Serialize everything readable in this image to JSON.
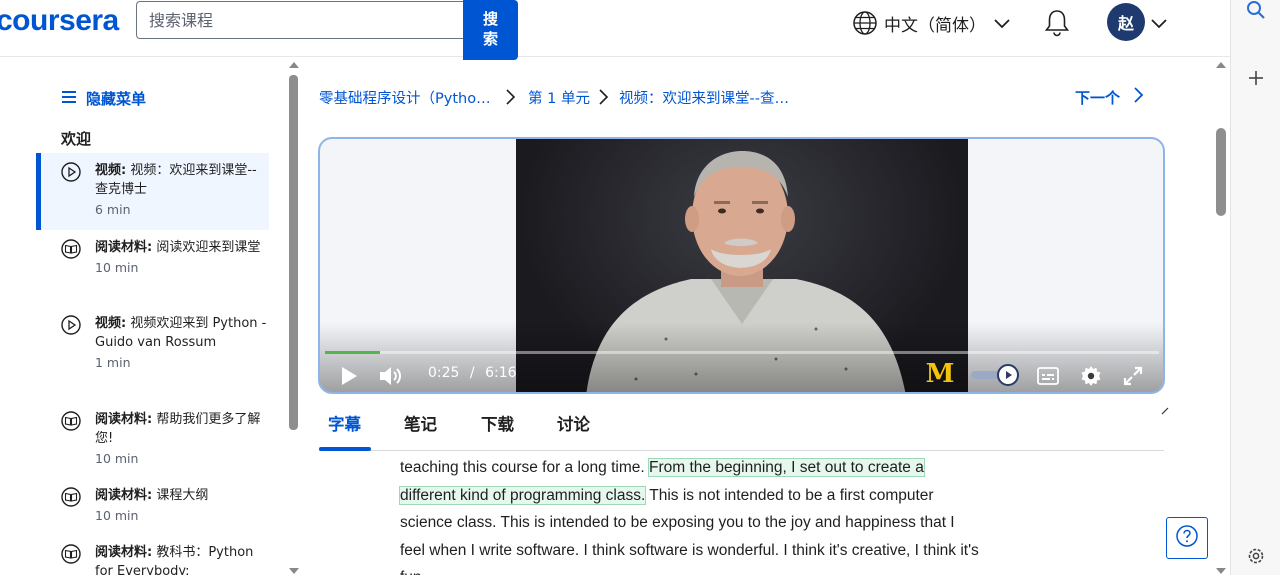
{
  "header": {
    "logo": "coursera",
    "search_placeholder": "搜索课程",
    "search_button": "搜索",
    "language": "中文（简体）",
    "avatar_initial": "赵"
  },
  "nav": {
    "hide_menu": "隐藏菜单",
    "section_title": "欢迎",
    "items": [
      {
        "type": "视频:",
        "title": " 视频：欢迎来到课堂--查克博士",
        "duration": "6 min",
        "icon": "play-circle-icon",
        "active": true
      },
      {
        "type": "阅读材料:",
        "title": " 阅读欢迎来到课堂",
        "duration": "10 min",
        "icon": "book-icon"
      },
      {
        "type": "视频:",
        "title": " 视频欢迎来到 Python - Guido van Rossum",
        "duration": "1 min",
        "icon": "play-circle-icon"
      },
      {
        "type": "阅读材料:",
        "title": " 帮助我们更多了解您!",
        "duration": "10 min",
        "icon": "book-icon"
      },
      {
        "type": "阅读材料:",
        "title": " 课程大纲",
        "duration": "10 min",
        "icon": "book-icon"
      },
      {
        "type": "阅读材料:",
        "title": " 教科书：Python for Everybody:",
        "duration": "",
        "icon": "book-icon"
      }
    ]
  },
  "breadcrumb": {
    "course": "零基础程序设计（Pytho…",
    "unit": "第 1 单元",
    "item": "视频：欢迎来到课堂--查…",
    "next": "下一个"
  },
  "player": {
    "current_time": "0:25",
    "separator": "/",
    "total_time": "6:16",
    "progress": 0.066,
    "logo": "M"
  },
  "tabs": [
    "字幕",
    "笔记",
    "下载",
    "讨论"
  ],
  "transcript": {
    "before": "teaching this course for a long time. ",
    "highlight": "From the beginning, I set out to create a different kind of programming class.",
    "after": " This is not intended to be a first computer science class. This is intended to be exposing you to the joy and happiness that I feel when I write software. I think software is wonderful. I think it's creative, I think it's fun."
  },
  "colors": {
    "brand": "#0056d2",
    "progress": "#52b64c",
    "avatar": "#1e3a6e"
  }
}
